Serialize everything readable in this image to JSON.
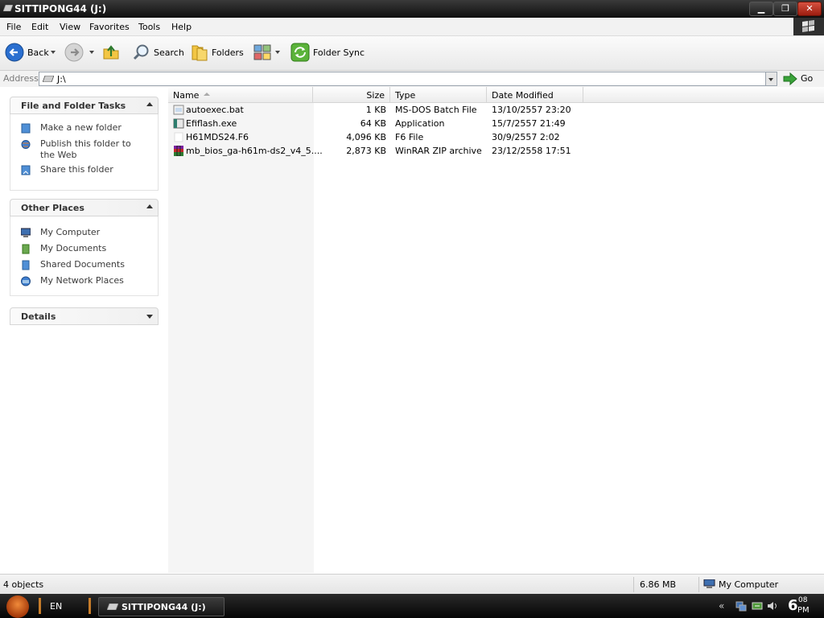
{
  "window": {
    "title": "SITTIPONG44 (J:)"
  },
  "menu": [
    "File",
    "Edit",
    "View",
    "Favorites",
    "Tools",
    "Help"
  ],
  "toolbar": {
    "back": "Back",
    "search": "Search",
    "folders": "Folders",
    "folder_sync": "Folder Sync"
  },
  "address": {
    "label": "Address",
    "value": "J:\\",
    "go": "Go"
  },
  "left_pane": {
    "file_tasks": {
      "title": "File and Folder Tasks",
      "items": [
        "Make a new folder",
        "Publish this folder to the Web",
        "Share this folder"
      ]
    },
    "other_places": {
      "title": "Other Places",
      "items": [
        "My Computer",
        "My Documents",
        "Shared Documents",
        "My Network Places"
      ]
    },
    "details": {
      "title": "Details"
    }
  },
  "columns": [
    "Name",
    "Size",
    "Type",
    "Date Modified"
  ],
  "files": [
    {
      "name": "autoexec.bat",
      "size": "1 KB",
      "type": "MS-DOS Batch File",
      "modified": "13/10/2557 23:20",
      "icon": "batch-file-icon"
    },
    {
      "name": "Efiflash.exe",
      "size": "64 KB",
      "type": "Application",
      "modified": "15/7/2557 21:49",
      "icon": "application-icon"
    },
    {
      "name": "H61MDS24.F6",
      "size": "4,096 KB",
      "type": "F6 File",
      "modified": "30/9/2557 2:02",
      "icon": "generic-file-icon"
    },
    {
      "name": "mb_bios_ga-h61m-ds2_v4_5....",
      "size": "2,873 KB",
      "type": "WinRAR ZIP archive",
      "modified": "23/12/2558 17:51",
      "icon": "winrar-archive-icon"
    }
  ],
  "status": {
    "count": "4 objects",
    "size": "6.86 MB",
    "location": "My Computer"
  },
  "taskbar": {
    "lang": "EN",
    "task_title": "SITTIPONG44 (J:)",
    "clock_hour": "6",
    "clock_minute": "08",
    "clock_ampm": "PM"
  }
}
